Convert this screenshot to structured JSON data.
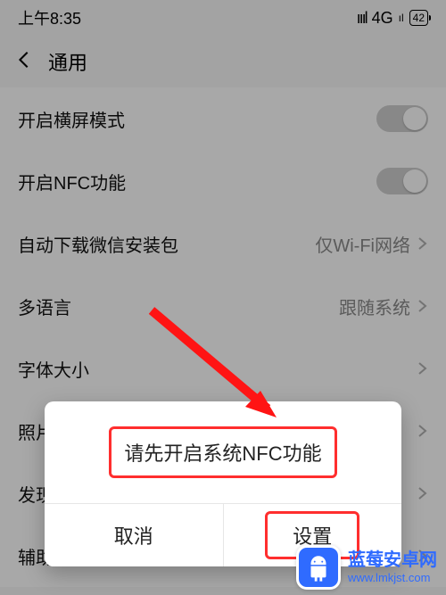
{
  "status": {
    "time": "上午8:35",
    "network": "4G",
    "battery": "42"
  },
  "nav": {
    "title": "通用"
  },
  "settings": {
    "landscape": {
      "label": "开启横屏模式"
    },
    "nfc": {
      "label": "开启NFC功能"
    },
    "autodl": {
      "label": "自动下载微信安装包",
      "value": "仅Wi-Fi网络"
    },
    "language": {
      "label": "多语言",
      "value": "跟随系统"
    },
    "fontsize": {
      "label": "字体大小"
    },
    "photos": {
      "label": "照片"
    },
    "discover": {
      "label": "发现"
    },
    "accessibility": {
      "label": "辅助功能"
    }
  },
  "dialog": {
    "title": "请先开启系统NFC功能",
    "cancel": "取消",
    "confirm": "设置"
  },
  "watermark": {
    "name": "蓝莓安卓网",
    "url": "www.lmkjst.com"
  }
}
